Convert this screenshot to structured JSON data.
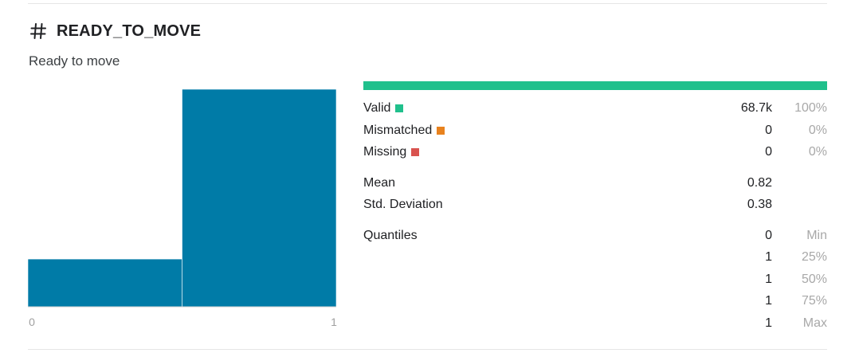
{
  "column": {
    "title": "READY_TO_MOVE",
    "description": "Ready to move",
    "type_icon": "hash-icon"
  },
  "colors": {
    "histogram": "#007ba7",
    "valid": "#20c08c",
    "mismatched": "#e8821e",
    "missing": "#d9534f"
  },
  "chart_data": {
    "type": "bar",
    "categories": [
      "0",
      "1"
    ],
    "values": [
      0.18,
      0.82
    ],
    "xlabel": "",
    "ylabel": "",
    "x_ticks": [
      "0",
      "1"
    ],
    "ylim": [
      0,
      0.82
    ]
  },
  "validity": {
    "valid": {
      "label": "Valid",
      "count": "68.7k",
      "pct": "100%",
      "fraction": 1.0
    },
    "mismatched": {
      "label": "Mismatched",
      "count": "0",
      "pct": "0%",
      "fraction": 0
    },
    "missing": {
      "label": "Missing",
      "count": "0",
      "pct": "0%",
      "fraction": 0
    }
  },
  "stats": {
    "mean": {
      "label": "Mean",
      "value": "0.82"
    },
    "std": {
      "label": "Std. Deviation",
      "value": "0.38"
    }
  },
  "quantiles": {
    "label": "Quantiles",
    "items": [
      {
        "value": "0",
        "name": "Min"
      },
      {
        "value": "1",
        "name": "25%"
      },
      {
        "value": "1",
        "name": "50%"
      },
      {
        "value": "1",
        "name": "75%"
      },
      {
        "value": "1",
        "name": "Max"
      }
    ]
  }
}
